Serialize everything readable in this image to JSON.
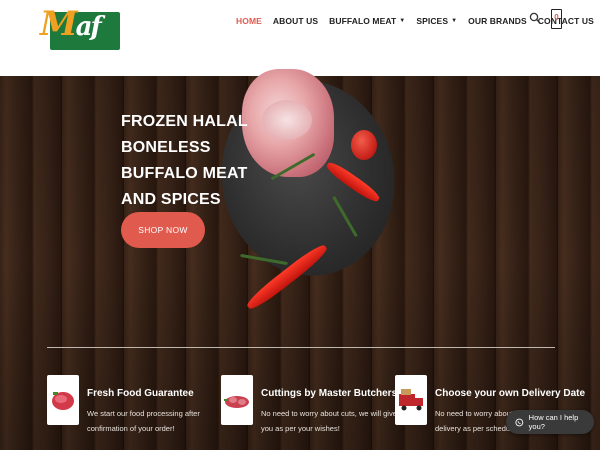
{
  "header": {
    "logo_text_m": "M",
    "logo_text_af": "af",
    "nav": [
      {
        "label": "HOME",
        "active": true,
        "dropdown": false
      },
      {
        "label": "ABOUT US",
        "active": false,
        "dropdown": false
      },
      {
        "label": "BUFFALO MEAT",
        "active": false,
        "dropdown": true
      },
      {
        "label": "SPICES",
        "active": false,
        "dropdown": true
      },
      {
        "label": "OUR BRANDS",
        "active": false,
        "dropdown": false
      },
      {
        "label": "CONTACT US",
        "active": false,
        "dropdown": false
      }
    ],
    "cart_count": "0",
    "icons": {
      "search": "search-icon",
      "cart": "cart-icon",
      "dropdown": "chevron-down-icon"
    }
  },
  "hero": {
    "title_lines": [
      "FROZEN HALAL",
      "BONELESS",
      "BUFFALO MEAT",
      "AND SPICES"
    ],
    "button_label": "SHOP NOW"
  },
  "features": [
    {
      "title": "Fresh Food Guarantee",
      "desc_lines": [
        "We start our food processing after",
        "confirmation of your order!"
      ],
      "icon": "fresh-meat-icon"
    },
    {
      "title": "Cuttings by Master Butchers",
      "desc_lines": [
        "No need to worry about cuts, we will give",
        "you as per your wishes!"
      ],
      "icon": "cut-meat-icon"
    },
    {
      "title": "Choose your own Delivery Date",
      "desc_lines": [
        "No need to worry about d",
        "delivery as per schedule"
      ],
      "icon": "delivery-truck-icon"
    }
  ],
  "chat": {
    "label": "How can I help you?",
    "icon": "whatsapp-icon"
  },
  "colors": {
    "accent": "#e05a4e",
    "logo_green": "#1e7a3c",
    "logo_orange": "#f0a020",
    "wood_dark": "#2b1910"
  }
}
